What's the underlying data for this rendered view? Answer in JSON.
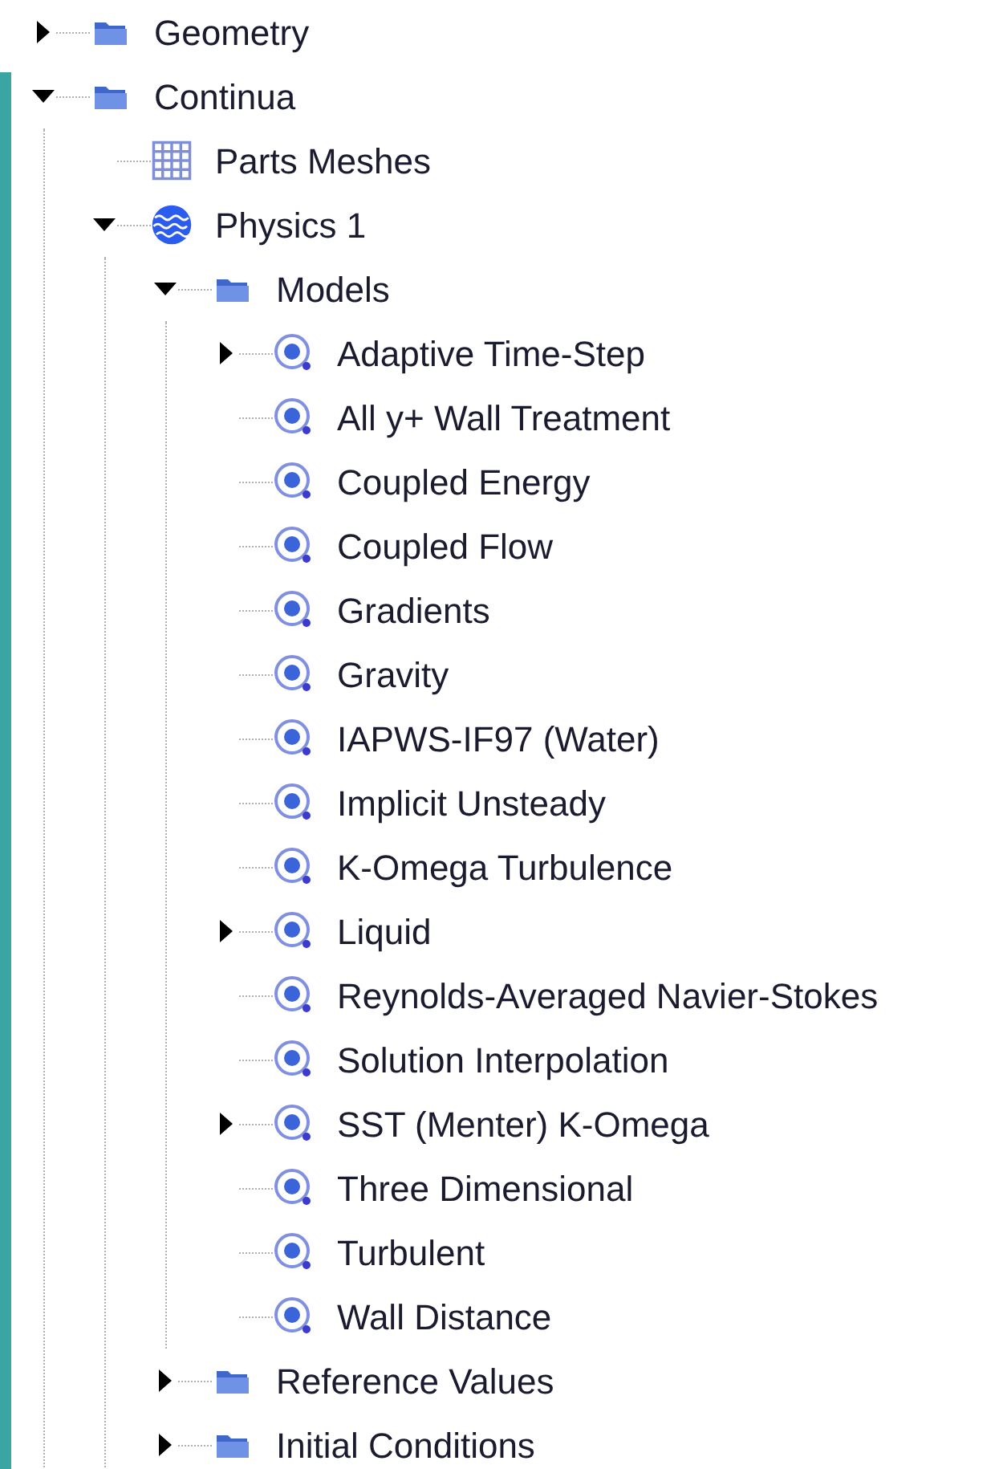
{
  "tree": [
    {
      "label": "Geometry",
      "kind": "folder",
      "expanded": false
    },
    {
      "label": "Continua",
      "kind": "folder",
      "expanded": true,
      "children": [
        {
          "label": "Parts Meshes",
          "kind": "mesh"
        },
        {
          "label": "Physics 1",
          "kind": "physics",
          "expanded": true,
          "children": [
            {
              "label": "Models",
              "kind": "folder",
              "expanded": true,
              "children": [
                {
                  "label": "Adaptive Time-Step",
                  "kind": "model",
                  "expanded": false
                },
                {
                  "label": "All y+ Wall Treatment",
                  "kind": "model"
                },
                {
                  "label": "Coupled Energy",
                  "kind": "model"
                },
                {
                  "label": "Coupled Flow",
                  "kind": "model"
                },
                {
                  "label": "Gradients",
                  "kind": "model"
                },
                {
                  "label": "Gravity",
                  "kind": "model"
                },
                {
                  "label": "IAPWS-IF97 (Water)",
                  "kind": "model"
                },
                {
                  "label": "Implicit Unsteady",
                  "kind": "model"
                },
                {
                  "label": "K-Omega Turbulence",
                  "kind": "model"
                },
                {
                  "label": "Liquid",
                  "kind": "model",
                  "expanded": false
                },
                {
                  "label": "Reynolds-Averaged Navier-Stokes",
                  "kind": "model"
                },
                {
                  "label": "Solution Interpolation",
                  "kind": "model"
                },
                {
                  "label": "SST (Menter) K-Omega",
                  "kind": "model",
                  "expanded": false
                },
                {
                  "label": "Three Dimensional",
                  "kind": "model"
                },
                {
                  "label": "Turbulent",
                  "kind": "model"
                },
                {
                  "label": "Wall Distance",
                  "kind": "model"
                }
              ]
            },
            {
              "label": "Reference Values",
              "kind": "folder",
              "expanded": false
            },
            {
              "label": "Initial Conditions",
              "kind": "folder",
              "expanded": false
            }
          ]
        }
      ]
    }
  ]
}
